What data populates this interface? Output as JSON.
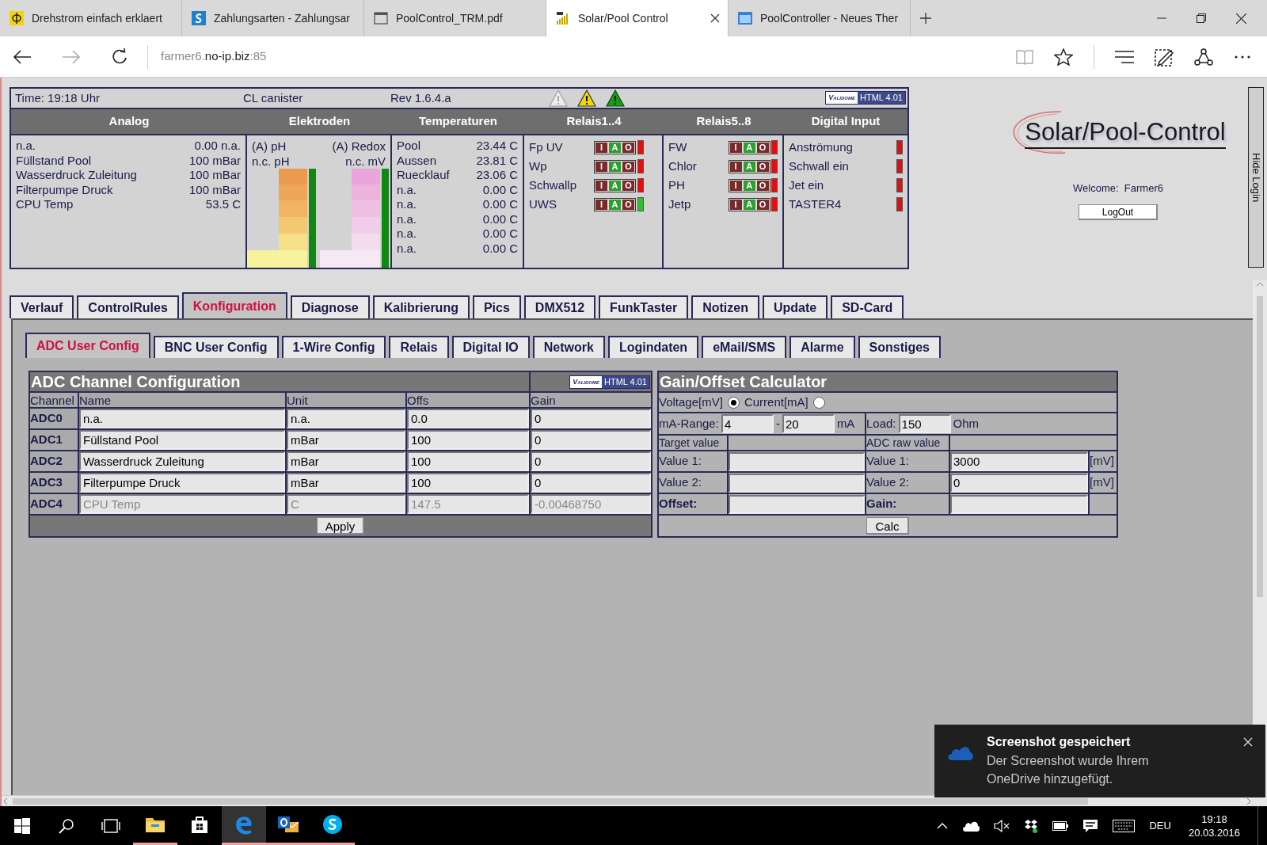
{
  "browser": {
    "tabs": [
      {
        "title": "Drehstrom einfach erklaert",
        "kind": "phi",
        "selected": false
      },
      {
        "title": "Zahlungsarten - Zahlungsar",
        "kind": "s-logo",
        "selected": false
      },
      {
        "title": "PoolControl_TRM.pdf",
        "kind": "document",
        "selected": false
      },
      {
        "title": "Solar/Pool Control",
        "kind": "bars",
        "selected": true
      },
      {
        "title": "PoolController - Neues Ther",
        "kind": "window",
        "selected": false
      }
    ],
    "address": [
      {
        "text": "farmer6.",
        "strong": false
      },
      {
        "text": "no-ip.biz",
        "strong": true
      },
      {
        "text": ":85",
        "strong": false
      }
    ]
  },
  "status": {
    "time": "Time: 19:18 Uhr",
    "mode": "CL canister",
    "revision": "Rev 1.6.4.a",
    "badge": {
      "logo": "Validome",
      "label": "HTML 4.01"
    }
  },
  "sections": [
    "Analog",
    "Elektroden",
    "Temperaturen",
    "Relais1..4",
    "Relais5..8",
    "Digital Input"
  ],
  "analog": [
    {
      "name": "n.a.",
      "value": "0.00 n.a."
    },
    {
      "name": "Füllstand Pool",
      "value": "100 mBar"
    },
    {
      "name": "Wasserdruck Zuleitung",
      "value": "100 mBar"
    },
    {
      "name": "Filterpumpe Druck",
      "value": "100 mBar"
    },
    {
      "name": "CPU Temp",
      "value": "53.5 C"
    }
  ],
  "electrodes": [
    "(A) pH",
    "(A) Redox",
    "n.c. pH",
    "n.c. mV"
  ],
  "temperatures": [
    {
      "name": "Pool",
      "value": "23.44 C"
    },
    {
      "name": "Aussen",
      "value": "23.81 C"
    },
    {
      "name": "Ruecklauf",
      "value": "23.06 C"
    },
    {
      "name": "n.a.",
      "value": "0.00 C"
    },
    {
      "name": "n.a.",
      "value": "0.00 C"
    },
    {
      "name": "n.a.",
      "value": "0.00 C"
    },
    {
      "name": "n.a.",
      "value": "0.00 C"
    },
    {
      "name": "n.a.",
      "value": "0.00 C"
    }
  ],
  "relays_1_4": [
    {
      "name": "Fp UV",
      "on": false,
      "buttons": [
        {
          "label": "I",
          "selected": false
        },
        {
          "label": "A",
          "selected": true
        },
        {
          "label": "O",
          "selected": false
        }
      ]
    },
    {
      "name": "Wp",
      "on": false,
      "buttons": [
        {
          "label": "I",
          "selected": false
        },
        {
          "label": "A",
          "selected": true
        },
        {
          "label": "O",
          "selected": false
        }
      ]
    },
    {
      "name": "Schwallp",
      "on": false,
      "buttons": [
        {
          "label": "I",
          "selected": false
        },
        {
          "label": "A",
          "selected": true
        },
        {
          "label": "O",
          "selected": false
        }
      ]
    },
    {
      "name": "UWS",
      "on": true,
      "buttons": [
        {
          "label": "I",
          "selected": false
        },
        {
          "label": "A",
          "selected": true
        },
        {
          "label": "O",
          "selected": false
        }
      ]
    }
  ],
  "relays_5_8": [
    {
      "name": "FW",
      "on": false,
      "buttons": [
        {
          "label": "I",
          "selected": false
        },
        {
          "label": "A",
          "selected": true
        },
        {
          "label": "O",
          "selected": false
        }
      ]
    },
    {
      "name": "Chlor",
      "on": false,
      "buttons": [
        {
          "label": "I",
          "selected": false
        },
        {
          "label": "A",
          "selected": true
        },
        {
          "label": "O",
          "selected": false
        }
      ]
    },
    {
      "name": "PH",
      "on": false,
      "buttons": [
        {
          "label": "I",
          "selected": false
        },
        {
          "label": "A",
          "selected": true
        },
        {
          "label": "O",
          "selected": false
        }
      ]
    },
    {
      "name": "Jetp",
      "on": false,
      "buttons": [
        {
          "label": "I",
          "selected": false
        },
        {
          "label": "A",
          "selected": true
        },
        {
          "label": "O",
          "selected": false
        }
      ]
    }
  ],
  "digital_inputs": [
    {
      "name": "Anströmung",
      "on": false
    },
    {
      "name": "Schwall ein",
      "on": false
    },
    {
      "name": "Jet ein",
      "on": false
    },
    {
      "name": "TASTER4",
      "on": false
    }
  ],
  "login": {
    "logo": "Solar/Pool-Control",
    "welcome": "Welcome:  Farmer6",
    "button": "LogOut",
    "hide": "Hide Login"
  },
  "main_tabs": [
    {
      "label": "Verlauf",
      "selected": false
    },
    {
      "label": "ControlRules",
      "selected": false
    },
    {
      "label": "Konfiguration",
      "selected": true
    },
    {
      "label": "Diagnose",
      "selected": false
    },
    {
      "label": "Kalibrierung",
      "selected": false
    },
    {
      "label": "Pics",
      "selected": false
    },
    {
      "label": "DMX512",
      "selected": false
    },
    {
      "label": "FunkTaster",
      "selected": false
    },
    {
      "label": "Notizen",
      "selected": false
    },
    {
      "label": "Update",
      "selected": false
    },
    {
      "label": "SD-Card",
      "selected": false
    }
  ],
  "sub_tabs": [
    {
      "label": "ADC User Config",
      "selected": true
    },
    {
      "label": "BNC User Config",
      "selected": false
    },
    {
      "label": "1-Wire Config",
      "selected": false
    },
    {
      "label": "Relais",
      "selected": false
    },
    {
      "label": "Digital IO",
      "selected": false
    },
    {
      "label": "Network",
      "selected": false
    },
    {
      "label": "Logindaten",
      "selected": false
    },
    {
      "label": "eMail/SMS",
      "selected": false
    },
    {
      "label": "Alarme",
      "selected": false
    },
    {
      "label": "Sonstiges",
      "selected": false
    }
  ],
  "adc": {
    "title": "ADC Channel Configuration",
    "badge": {
      "logo": "Validome",
      "label": "HTML 4.01"
    },
    "columns": [
      "Channel",
      "Name",
      "Unit",
      "Offs",
      "Gain"
    ],
    "rows": [
      {
        "channel": "ADC0",
        "name": "n.a.",
        "unit": "n.a.",
        "offs": "0.0",
        "gain": "0",
        "disabled": false
      },
      {
        "channel": "ADC1",
        "name": "Füllstand Pool",
        "unit": "mBar",
        "offs": "100",
        "gain": "0",
        "disabled": false
      },
      {
        "channel": "ADC2",
        "name": "Wasserdruck Zuleitung",
        "unit": "mBar",
        "offs": "100",
        "gain": "0",
        "disabled": false
      },
      {
        "channel": "ADC3",
        "name": "Filterpumpe Druck",
        "unit": "mBar",
        "offs": "100",
        "gain": "0",
        "disabled": false
      },
      {
        "channel": "ADC4",
        "name": "CPU Temp",
        "unit": "C",
        "offs": "147.5",
        "gain": "-0.00468750",
        "disabled": true
      }
    ],
    "button": "Apply"
  },
  "calc": {
    "title": "Gain/Offset Calculator",
    "modes": [
      {
        "label": "Voltage[mV]",
        "selected": true
      },
      {
        "label": "Current[mA]",
        "selected": false
      }
    ],
    "range_label": "mA-Range:",
    "range_from": "4",
    "range_sep": "-",
    "range_to": "20",
    "range_unit": "mA",
    "load_label": "Load:",
    "load": "150",
    "load_unit": "Ohm",
    "target_header": "Target value",
    "raw_header": "ADC raw value",
    "rows": [
      {
        "kind": "value",
        "label": "Value 1:",
        "raw_label": "Value 1:",
        "raw": "3000",
        "unit": "[mV]"
      },
      {
        "kind": "value",
        "label": "Value 2:",
        "raw_label": "Value 2:",
        "raw": "0",
        "unit": "[mV]"
      },
      {
        "kind": "result",
        "label": "Offset:",
        "raw_label": "Gain:"
      }
    ],
    "button": "Calc"
  },
  "notification": {
    "title": "Screenshot gespeichert",
    "body": "Der Screenshot wurde Ihrem OneDrive hinzugefügt."
  },
  "taskbar": {
    "apps": [
      {
        "kind": "explorer",
        "running": true,
        "selected": false
      },
      {
        "kind": "store",
        "running": false,
        "selected": false
      },
      {
        "kind": "edge",
        "running": true,
        "selected": true
      },
      {
        "kind": "outlook",
        "running": true,
        "selected": false
      },
      {
        "kind": "skype",
        "running": true,
        "selected": false
      }
    ],
    "language": "DEU",
    "time": "19:18",
    "date": "20.03.2016"
  }
}
